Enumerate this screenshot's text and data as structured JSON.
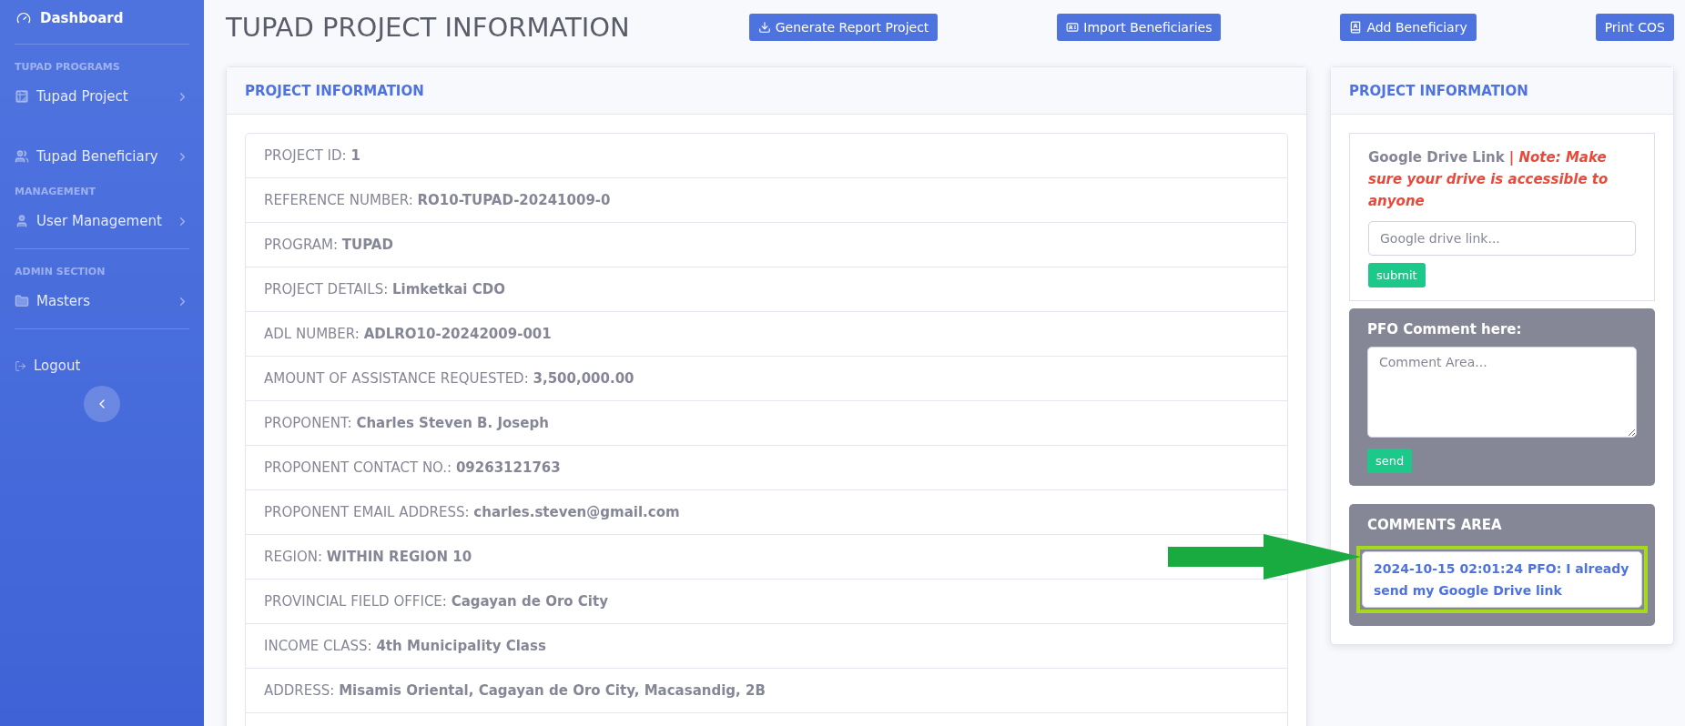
{
  "sidebar": {
    "items": [
      {
        "kind": "brand",
        "label": "Dashboard"
      },
      {
        "kind": "divider"
      },
      {
        "kind": "heading",
        "label": "TUPAD PROGRAMS"
      },
      {
        "kind": "item",
        "label": "Tupad Project"
      },
      {
        "kind": "spacer"
      },
      {
        "kind": "item",
        "label": "Tupad Beneficiary"
      },
      {
        "kind": "heading",
        "label": "MANAGEMENT"
      },
      {
        "kind": "item",
        "label": "User Management"
      },
      {
        "kind": "divider"
      },
      {
        "kind": "heading",
        "label": "ADMIN SECTION"
      },
      {
        "kind": "item",
        "label": "Masters"
      },
      {
        "kind": "divider"
      },
      {
        "kind": "logout",
        "label": "Logout"
      }
    ]
  },
  "page_title": "TUPAD PROJECT INFORMATION",
  "actions": [
    {
      "label": "Generate Report Project"
    },
    {
      "label": "Import Beneficiaries"
    },
    {
      "label": "Add Beneficiary"
    },
    {
      "label": "Print COS"
    }
  ],
  "project_card": {
    "title": "PROJECT INFORMATION",
    "rows": [
      {
        "label": "PROJECT ID:",
        "value": "1"
      },
      {
        "label": "REFERENCE NUMBER:",
        "value": "RO10-TUPAD-20241009-0"
      },
      {
        "label": "PROGRAM:",
        "value": "TUPAD"
      },
      {
        "label": "PROJECT DETAILS:",
        "value": "Limketkai CDO"
      },
      {
        "label": "ADL NUMBER:",
        "value": "ADLRO10-20242009-001"
      },
      {
        "label": "AMOUNT OF ASSISTANCE REQUESTED:",
        "value": "3,500,000.00"
      },
      {
        "label": "PROPONENT:",
        "value": "Charles Steven B. Joseph"
      },
      {
        "label": "PROPONENT CONTACT NO.:",
        "value": "09263121763"
      },
      {
        "label": "PROPONENT EMAIL ADDRESS:",
        "value": "charles.steven@gmail.com"
      },
      {
        "label": "REGION:",
        "value": "WITHIN REGION 10"
      },
      {
        "label": "PROVINCIAL FIELD OFFICE:",
        "value": "Cagayan de Oro City"
      },
      {
        "label": "INCOME CLASS:",
        "value": "4th Municipality Class"
      },
      {
        "label": "ADDRESS:",
        "value": "Misamis Oriental, Cagayan de Oro City, Macasandig, 2B"
      }
    ]
  },
  "side_card": {
    "title": "PROJECT INFORMATION",
    "drive": {
      "label": "Google Drive Link",
      "note": "| Note: Make sure your drive is accessible to anyone",
      "placeholder": "Google drive link...",
      "button": "submit"
    },
    "pfo": {
      "label": "PFO Comment here:",
      "placeholder": "Comment Area...",
      "button": "send"
    },
    "comments": {
      "title": "COMMENTS AREA",
      "items": [
        {
          "text": "2024-10-15 02:01:24 PFO: I already send my Google Drive link",
          "highlighted": true
        }
      ]
    }
  }
}
